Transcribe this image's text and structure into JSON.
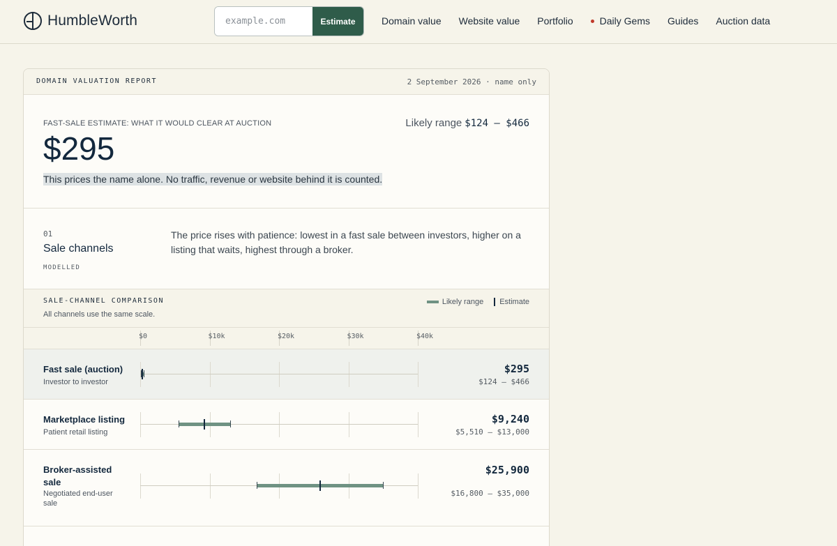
{
  "brand": {
    "name": "HumbleWorth"
  },
  "search": {
    "placeholder": "example.com",
    "button_label": "Estimate"
  },
  "nav": {
    "items": [
      "Domain value",
      "Website value",
      "Portfolio",
      "Daily Gems",
      "Guides",
      "Auction data"
    ],
    "dot_color": "#c0392b"
  },
  "report": {
    "header_label": "DOMAIN VALUATION REPORT",
    "date": "2 September 2026 · name only",
    "estimate_label": "FAST-SALE ESTIMATE: WHAT IT WOULD CLEAR AT AUCTION",
    "estimate_value": "$295",
    "range_label": "Likely range",
    "range_value": "$124 – $466",
    "note": "This prices the name alone. No traffic, revenue or website behind it is counted."
  },
  "section": {
    "number": "01",
    "title": "Sale channels",
    "tag": "MODELLED",
    "description": "The price rises with patience: lowest in a fast sale between investors, higher on a listing that waits, highest through a broker."
  },
  "comparison": {
    "title": "SALE-CHANNEL COMPARISON",
    "subtitle": "All channels use the same scale.",
    "legend_range": "Likely range",
    "legend_estimate": "Estimate",
    "accent_color": "#6f9283"
  },
  "chart_data": {
    "type": "range",
    "x_ticks": [
      "$0",
      "$10k",
      "$20k",
      "$30k",
      "$40k"
    ],
    "xlim": [
      0,
      40000
    ],
    "series": [
      {
        "name": "Fast sale (auction)",
        "sub": "Investor to investor",
        "estimate": 295,
        "low": 124,
        "high": 466,
        "value_label": "$295",
        "range_label": "$124 – $466",
        "highlight": true
      },
      {
        "name": "Marketplace listing",
        "sub": "Patient retail listing",
        "estimate": 9240,
        "low": 5510,
        "high": 13000,
        "value_label": "$9,240",
        "range_label": "$5,510 – $13,000",
        "highlight": false
      },
      {
        "name": "Broker-assisted sale",
        "sub": "Negotiated end-user sale",
        "estimate": 25900,
        "low": 16800,
        "high": 35000,
        "value_label": "$25,900",
        "range_label": "$16,800 – $35,000",
        "highlight": false
      }
    ]
  }
}
